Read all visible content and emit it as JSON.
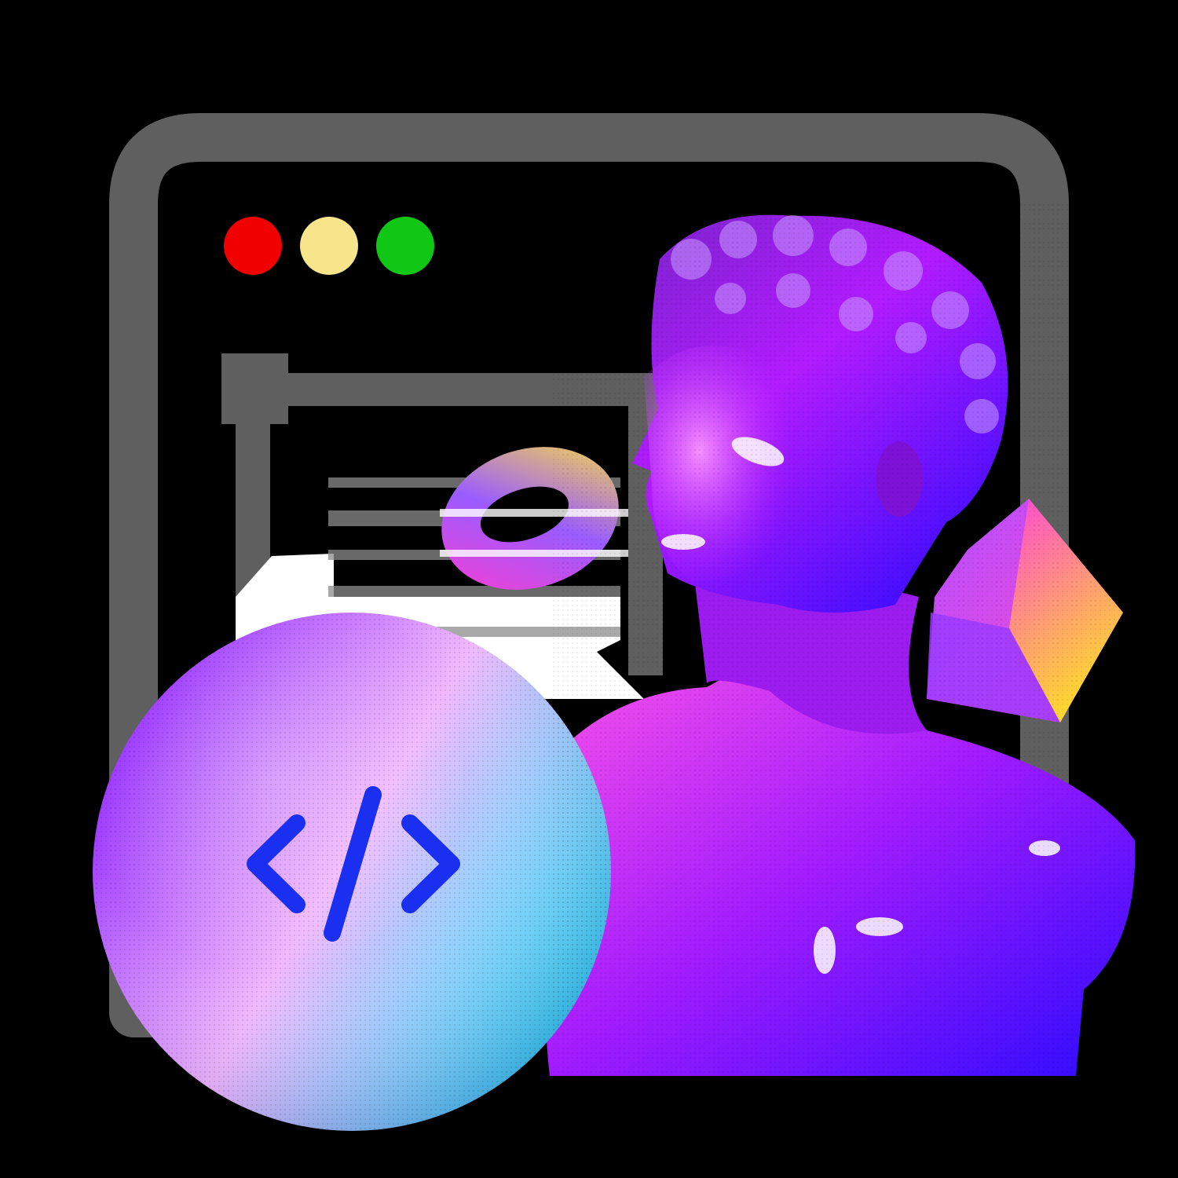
{
  "scene": {
    "background": "#000000",
    "window": {
      "frame_color": "#5f5f5f",
      "traffic_lights": [
        {
          "name": "close",
          "color": "#f00000"
        },
        {
          "name": "minimize",
          "color": "#f7e48b"
        },
        {
          "name": "maximize",
          "color": "#11c716"
        }
      ]
    },
    "code_badge": {
      "icon": "code-brackets-icon",
      "glyph_color": "#1a2ff0",
      "gradient": [
        "#8b1cff",
        "#f1b8ff",
        "#15f4ff"
      ]
    },
    "bust": {
      "description_icon": "classical-bust-icon",
      "palette": [
        "#6a18c8",
        "#b21bff",
        "#ff55e8",
        "#2c0bff",
        "#ffffff"
      ]
    },
    "ring": {
      "icon": "torus-icon",
      "gradient": [
        "#ff3bd0",
        "#9a5cff",
        "#ffe23d"
      ]
    },
    "cube": {
      "icon": "cube-icon",
      "gradient": [
        "#b24dff",
        "#ff4ad3",
        "#ffd92e"
      ]
    }
  }
}
